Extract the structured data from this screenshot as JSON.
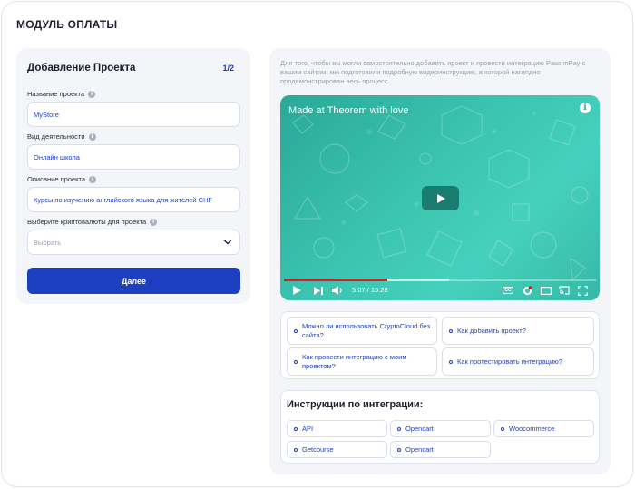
{
  "page": {
    "title": "МОДУЛЬ ОПЛАТЫ"
  },
  "form": {
    "title": "Добавление Проекта",
    "step": "1/2",
    "fields": [
      {
        "label": "Название проекта",
        "value": "MyStore"
      },
      {
        "label": "Вид деятельности",
        "value": "Онлайн школа"
      },
      {
        "label": "Описание проекта",
        "value": "Курсы по изучению английского языка для жителей СНГ"
      }
    ],
    "crypto": {
      "label": "Выберите криптовалюты для проекта",
      "placeholder": "Выбрать"
    },
    "next_label": "Далее"
  },
  "help": {
    "intro": "Для того, чтобы вы могли самостоятельно добавить проект и провести интеграцию PassimPay с вашим сайтом, мы подготовили подробную видеоинструкцию, в которой наглядно продемонстрирован весь процесс."
  },
  "video": {
    "title": "Made at Theorem with love",
    "time": "5:07 / 15:28",
    "progress_fraction": 0.33,
    "buffer_fraction": 0.53,
    "background_color": "#3cc5b1",
    "progress_color": "#e01b1b"
  },
  "faq": [
    "Можно ли использовать CryptoCloud без сайта?",
    "Как добавить проект?",
    "Как провести интеграцию с моим проектом?",
    "Как протестировать интеграцию?"
  ],
  "instructions": {
    "title": "Инструкции по интеграции:",
    "items": [
      "API",
      "Opencart",
      "Woocommerce",
      "Getcourse",
      "Opencart"
    ]
  },
  "colors": {
    "accent": "#1e3fbf",
    "panel": "#f3f5f8",
    "muted_text": "#9aa0ab"
  }
}
